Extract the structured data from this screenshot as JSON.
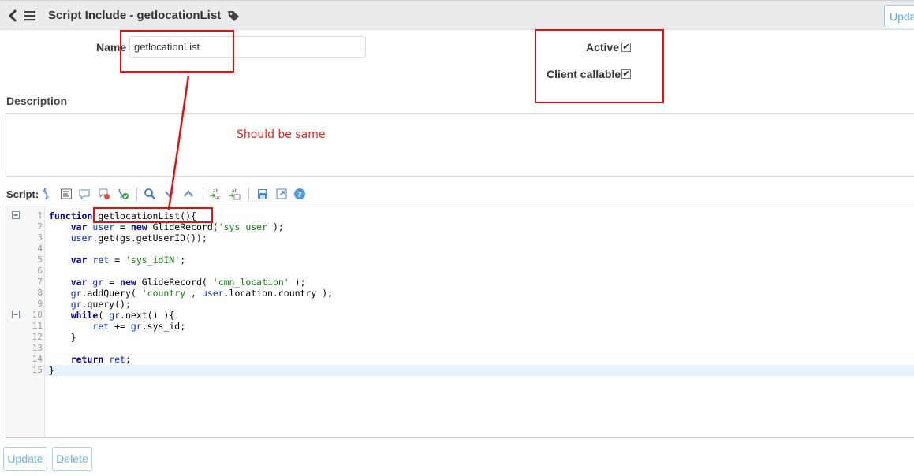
{
  "header": {
    "title": "Script Include - getlocationList",
    "update_label": "Update",
    "back_icon": "chevron-left-icon",
    "menu_icon": "hamburger-menu-icon",
    "tag_icon": "tag-icon"
  },
  "form": {
    "name_label": "Name",
    "name_value": "getlocationList",
    "active_label": "Active",
    "active_checked": true,
    "client_callable_label": "Client callable",
    "client_callable_checked": true,
    "description_label": "Description",
    "description_value": "",
    "script_label": "Script:"
  },
  "annotation": {
    "text": "Should be same",
    "color": "#e3110e"
  },
  "toolbar": {
    "icons": [
      "toggle-syntax-icon",
      "format-code-icon",
      "comment-icon",
      "uncomment-icon",
      "check-syntax-icon",
      "search-icon",
      "find-next-icon",
      "find-previous-icon",
      "replace-icon",
      "replace-all-icon",
      "save-icon",
      "fullscreen-icon",
      "help-icon"
    ]
  },
  "editor": {
    "line_numbers": [
      "1",
      "2",
      "3",
      "4",
      "5",
      "6",
      "7",
      "8",
      "9",
      "10",
      "11",
      "12",
      "13",
      "14",
      "15"
    ],
    "fold_lines": [
      1,
      10
    ],
    "active_line": 15,
    "lines": [
      "function getlocationList(){",
      "    var user = new GlideRecord('sys_user');",
      "    user.get(gs.getUserID());",
      "",
      "    var ret = 'sys_idIN';",
      "",
      "    var gr = new GlideRecord( 'cmn_location' );",
      "    gr.addQuery( 'country', user.location.country );",
      "    gr.query();",
      "    while( gr.next() ){",
      "        ret += gr.sys_id;",
      "    }",
      "",
      "    return ret;",
      "}"
    ]
  },
  "buttons": {
    "update_label": "Update",
    "delete_label": "Delete"
  },
  "colors": {
    "header_bg": "#e9ebed",
    "button_border": "#a9d2f2",
    "button_text": "#6aaee6",
    "keyword": "#00008b",
    "string": "#0d7f0d",
    "variable": "#0a2bd2"
  }
}
